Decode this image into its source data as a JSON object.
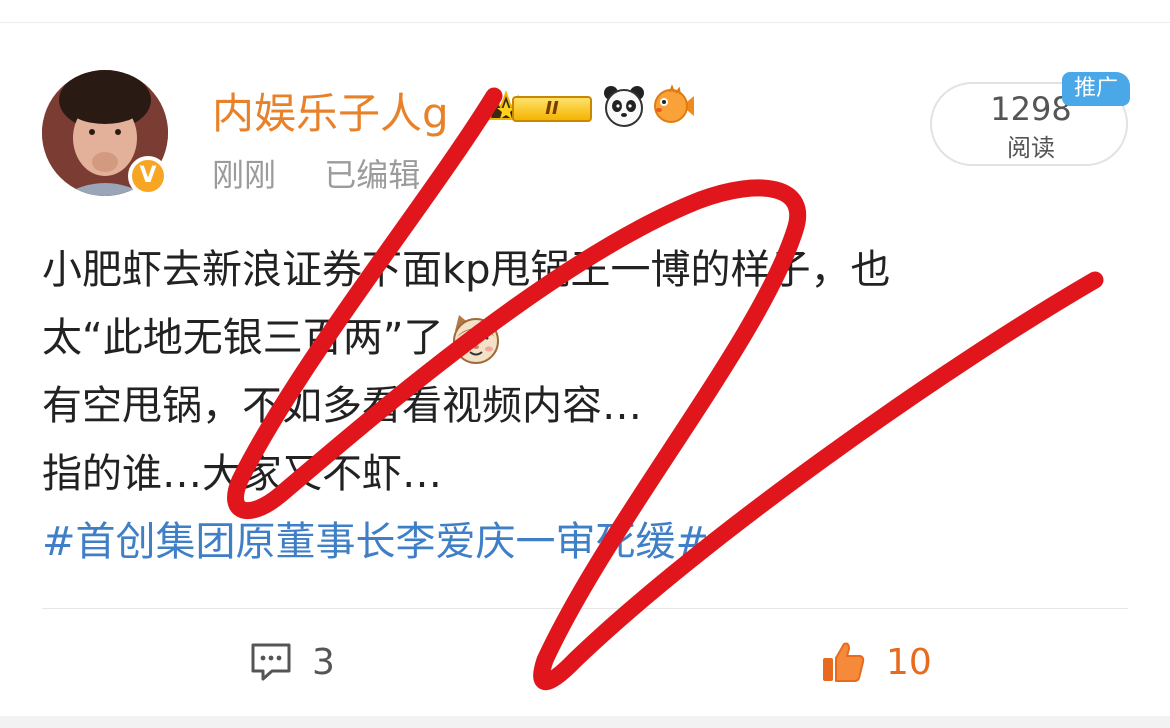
{
  "author": {
    "name": "内娱乐子人g",
    "verified_mark": "V",
    "badges": [
      "crown-vip-badge-icon",
      "panda-emoji-icon",
      "pufferfish-emoji-icon"
    ],
    "vip_level": "II"
  },
  "meta": {
    "time": "刚刚",
    "edited": "已编辑"
  },
  "stats": {
    "read_count": "1298",
    "read_label": "阅读",
    "promo_label": "推广"
  },
  "post": {
    "lines": [
      "小肥虾去新浪证券下面kp甩锅王一博的样子，也",
      "太“此地无银三百两”了",
      "有空甩锅，不如多看看视频内容…",
      "指的谁…大家又不虾…"
    ],
    "hashtag": "#首创集团原董事长李爱庆一审死缓#",
    "emoji": "cat-emoji-icon"
  },
  "actions": {
    "comment_count": "3",
    "like_count": "10"
  },
  "colors": {
    "username": "#e8822a",
    "hashtag": "#3f7fc7",
    "like": "#e86a1f",
    "scribble": "#e0161c",
    "promo": "#4aa7e8"
  }
}
